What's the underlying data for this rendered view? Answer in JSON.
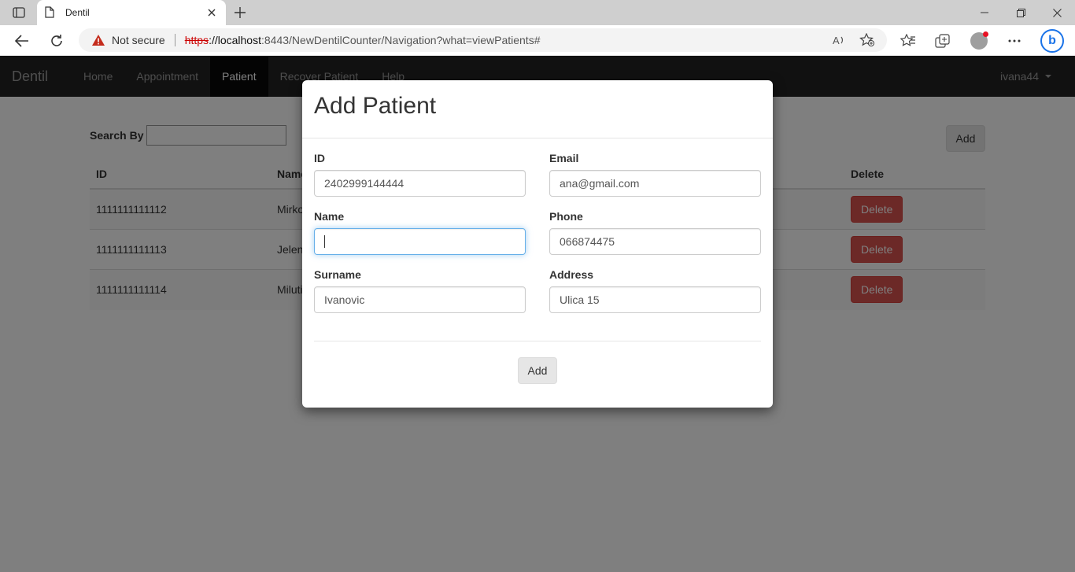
{
  "browser": {
    "tab_title": "Dentil",
    "not_secure": "Not secure",
    "url_scheme": "https",
    "url_host": "://localhost",
    "url_rest": ":8443/NewDentilCounter/Navigation?what=viewPatients#"
  },
  "navbar": {
    "brand": "Dentil",
    "items": [
      "Home",
      "Appointment",
      "Patient",
      "Recover Patient",
      "Help"
    ],
    "active": "Patient",
    "user": "ivana44"
  },
  "page": {
    "search_label": "Search By",
    "add_label": "Add",
    "table": {
      "headers": [
        "ID",
        "Name",
        "Delete"
      ],
      "rows": [
        {
          "id": "1111111111112",
          "name": "Mirko",
          "action": "Delete"
        },
        {
          "id": "1111111111113",
          "name": "Jelen",
          "action": "Delete"
        },
        {
          "id": "1111111111114",
          "name": "Miluti",
          "action": "Delete"
        }
      ]
    }
  },
  "modal": {
    "title": "Add Patient",
    "fields": {
      "id": {
        "label": "ID",
        "value": "2402999144444"
      },
      "email": {
        "label": "Email",
        "value": "ana@gmail.com"
      },
      "name": {
        "label": "Name",
        "value": ""
      },
      "phone": {
        "label": "Phone",
        "value": "066874475"
      },
      "surname": {
        "label": "Surname",
        "value": "Ivanovic"
      },
      "address": {
        "label": "Address",
        "value": "Ulica 15"
      }
    },
    "submit_label": "Add"
  },
  "colors": {
    "navbar_bg": "#222222",
    "delete_button": "#d9534f",
    "focus_border": "#66afe9"
  }
}
